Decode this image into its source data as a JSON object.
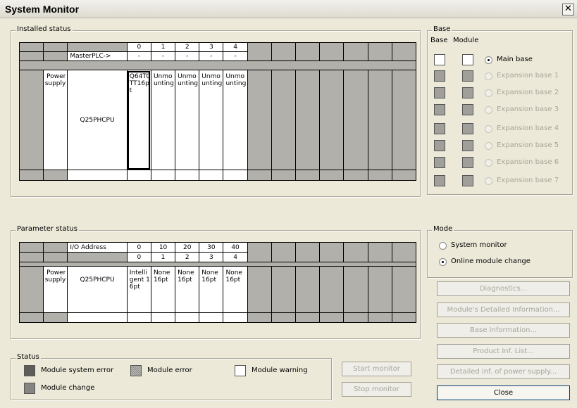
{
  "window": {
    "title": "System Monitor",
    "close_glyph": "✕"
  },
  "installed": {
    "legend": "Installed status",
    "header_slots": [
      "0",
      "1",
      "2",
      "3",
      "4"
    ],
    "master_label": "MasterPLC->",
    "master_values": [
      "-",
      "-",
      "-",
      "-",
      "-"
    ],
    "power": "Power supply",
    "cpu": "Q25PHCPU",
    "modules": [
      "Q64TCTT16pt",
      "Unmounting",
      "Unmounting",
      "Unmounting",
      "Unmounting"
    ]
  },
  "parameter": {
    "legend": "Parameter status",
    "io_label": "I/O Address",
    "io_values": [
      "0",
      "10",
      "20",
      "30",
      "40"
    ],
    "slot_values": [
      "0",
      "1",
      "2",
      "3",
      "4"
    ],
    "power": "Power supply",
    "cpu": "Q25PHCPU",
    "modules": [
      "Intelligent 16pt",
      "None 16pt",
      "None 16pt",
      "None 16pt",
      "None 16pt"
    ]
  },
  "base": {
    "legend": "Base",
    "col_base": "Base",
    "col_module": "Module",
    "options": [
      {
        "label": "Main base",
        "selected": true,
        "enabled": true
      },
      {
        "label": "Expansion base 1",
        "selected": false,
        "enabled": false
      },
      {
        "label": "Expansion base 2",
        "selected": false,
        "enabled": false
      },
      {
        "label": "Expansion base 3",
        "selected": false,
        "enabled": false
      },
      {
        "label": "Expansion base 4",
        "selected": false,
        "enabled": false
      },
      {
        "label": "Expansion base 5",
        "selected": false,
        "enabled": false
      },
      {
        "label": "Expansion base 6",
        "selected": false,
        "enabled": false
      },
      {
        "label": "Expansion base 7",
        "selected": false,
        "enabled": false
      }
    ]
  },
  "mode": {
    "legend": "Mode",
    "options": [
      {
        "label": "System monitor",
        "selected": false
      },
      {
        "label": "Online module change",
        "selected": true
      }
    ]
  },
  "buttons": {
    "diagnostics": "Diagnostics...",
    "module_detail": "Module's Detailed Information...",
    "base_info": "Base Information...",
    "product_inf": "Product Inf. List...",
    "power_detail": "Detailed inf. of power supply...",
    "close": "Close",
    "start_monitor": "Start monitor",
    "stop_monitor": "Stop monitor"
  },
  "status": {
    "legend": "Status",
    "module_system_error": "Module system error",
    "module_error": "Module error",
    "module_warning": "Module warning",
    "module_change": "Module change"
  },
  "colors": {
    "dialog_bg": "#ece9d8",
    "slot_gray": "#b2b0ab",
    "disabled_text": "#a8a69b"
  }
}
